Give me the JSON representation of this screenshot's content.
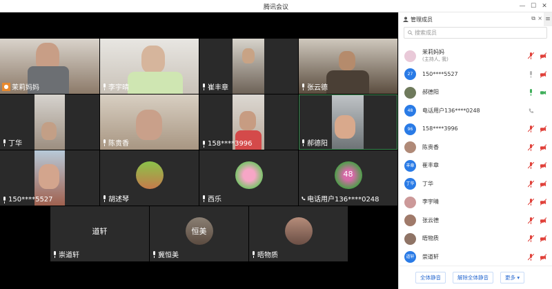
{
  "window": {
    "title": "腾讯会议"
  },
  "tiles": [
    {
      "name": "茉莉妈妈",
      "host": true
    },
    {
      "name": "李宇晴"
    },
    {
      "name": "崔丰章"
    },
    {
      "name": "张云德"
    },
    {
      "name": "丁华"
    },
    {
      "name": "陈贵香"
    },
    {
      "name": "158****3996"
    },
    {
      "name": "郝德阳"
    },
    {
      "name": "150****5527"
    },
    {
      "name": "胡述琴"
    },
    {
      "name": "西乐"
    },
    {
      "name": "电话用户136****0248",
      "avatar_text": "48",
      "phone": true
    },
    {
      "name": "崇道轩",
      "avatar_text": "道轩"
    },
    {
      "name": "冀恒美",
      "avatar_text": "恒美"
    },
    {
      "name": "晤物质"
    }
  ],
  "sidebar": {
    "title": "管理成员",
    "search_placeholder": "搜索成员",
    "members": [
      {
        "name": "茉莉妈妈",
        "sub": "(主持人, 我)",
        "avatar": "",
        "mic": "muted",
        "cam": "off"
      },
      {
        "name": "150****5527",
        "avatar": "27",
        "mic": "on-gray",
        "cam": "off"
      },
      {
        "name": "郝德阳",
        "avatar": "",
        "mic": "on-green",
        "cam": "on"
      },
      {
        "name": "电话用户136****0248",
        "avatar": "48",
        "mic": "phone",
        "cam": ""
      },
      {
        "name": "158****3996",
        "avatar": "96",
        "mic": "muted",
        "cam": "off"
      },
      {
        "name": "陈贵香",
        "avatar": "",
        "mic": "muted",
        "cam": "off"
      },
      {
        "name": "崔丰章",
        "avatar": "丰章",
        "mic": "muted",
        "cam": "off"
      },
      {
        "name": "丁华",
        "avatar": "丁华",
        "mic": "muted",
        "cam": "off"
      },
      {
        "name": "李宇晴",
        "avatar": "",
        "mic": "muted",
        "cam": "off"
      },
      {
        "name": "张云德",
        "avatar": "",
        "mic": "muted",
        "cam": "off"
      },
      {
        "name": "晤物质",
        "avatar": "",
        "mic": "muted",
        "cam": "off"
      },
      {
        "name": "崇道轩",
        "avatar": "道轩",
        "mic": "muted",
        "cam": "off"
      }
    ],
    "footer": {
      "mute_all": "全体静音",
      "unmute_all": "解除全体静音",
      "more": "更多 ▾"
    }
  },
  "colors": {
    "accent": "#2a7be6",
    "muted": "#e0413a",
    "active_green": "#3fae5a"
  }
}
